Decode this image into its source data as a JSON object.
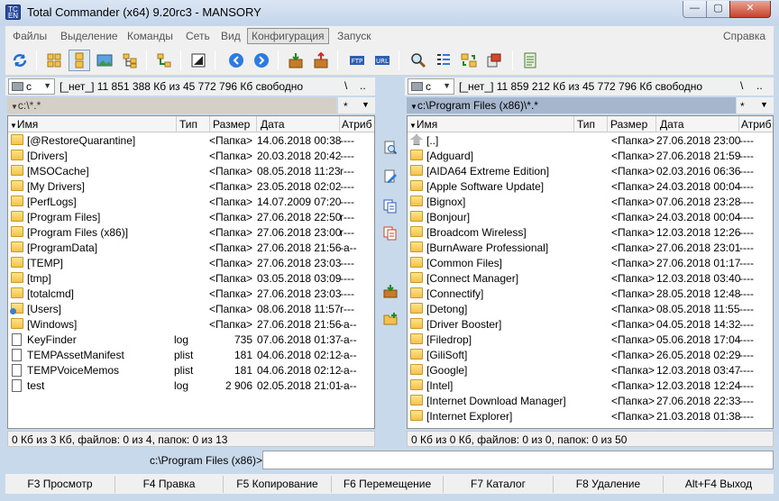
{
  "window": {
    "title": "Total Commander (x64) 9.20rc3 - MANSORY",
    "app_icon_text": "TC\nEN"
  },
  "menu": {
    "items": [
      "Файлы",
      "Выделение",
      "Команды",
      "Сеть",
      "Вид",
      "Конфигурация",
      "Запуск"
    ],
    "help": "Справка"
  },
  "left": {
    "drive": "c",
    "drive_info": "[_нет_]  11 851 388 Кб из 45 772 796 Кб свободно",
    "root": "\\",
    "up": "..",
    "path": "c:\\*.*",
    "filter": "*",
    "columns": {
      "name": "Имя",
      "type": "Тип",
      "size": "Размер",
      "date": "Дата",
      "attr": "Атриб"
    },
    "rows": [
      {
        "icon": "folder",
        "name": "[@RestoreQuarantine]",
        "type": "",
        "size": "<Папка>",
        "date": "14.06.2018 00:38",
        "attr": "----"
      },
      {
        "icon": "folder",
        "name": "[Drivers]",
        "type": "",
        "size": "<Папка>",
        "date": "20.03.2018 20:42",
        "attr": "----"
      },
      {
        "icon": "folder",
        "name": "[MSOCache]",
        "type": "",
        "size": "<Папка>",
        "date": "08.05.2018 11:23",
        "attr": "r---"
      },
      {
        "icon": "folder",
        "name": "[My Drivers]",
        "type": "",
        "size": "<Папка>",
        "date": "23.05.2018 02:02",
        "attr": "----"
      },
      {
        "icon": "folder",
        "name": "[PerfLogs]",
        "type": "",
        "size": "<Папка>",
        "date": "14.07.2009 07:20",
        "attr": "----"
      },
      {
        "icon": "folder",
        "name": "[Program Files]",
        "type": "",
        "size": "<Папка>",
        "date": "27.06.2018 22:50",
        "attr": "r---"
      },
      {
        "icon": "folder",
        "name": "[Program Files (x86)]",
        "type": "",
        "size": "<Папка>",
        "date": "27.06.2018 23:00",
        "attr": "r---"
      },
      {
        "icon": "folder",
        "name": "[ProgramData]",
        "type": "",
        "size": "<Папка>",
        "date": "27.06.2018 21:56",
        "attr": "-a--"
      },
      {
        "icon": "folder",
        "name": "[TEMP]",
        "type": "",
        "size": "<Папка>",
        "date": "27.06.2018 23:03",
        "attr": "----"
      },
      {
        "icon": "folder",
        "name": "[tmp]",
        "type": "",
        "size": "<Папка>",
        "date": "03.05.2018 03:09",
        "attr": "----"
      },
      {
        "icon": "folder",
        "name": "[totalcmd]",
        "type": "",
        "size": "<Папка>",
        "date": "27.06.2018 23:03",
        "attr": "----"
      },
      {
        "icon": "users",
        "name": "[Users]",
        "type": "",
        "size": "<Папка>",
        "date": "08.06.2018 11:57",
        "attr": "r---"
      },
      {
        "icon": "folder",
        "name": "[Windows]",
        "type": "",
        "size": "<Папка>",
        "date": "27.06.2018 21:56",
        "attr": "-a--"
      },
      {
        "icon": "file",
        "name": "KeyFinder",
        "type": "log",
        "size": "735",
        "date": "07.06.2018 01:37",
        "attr": "-a--"
      },
      {
        "icon": "file",
        "name": "TEMPAssetManifest",
        "type": "plist",
        "size": "181",
        "date": "04.06.2018 02:12",
        "attr": "-a--"
      },
      {
        "icon": "file",
        "name": "TEMPVoiceMemos",
        "type": "plist",
        "size": "181",
        "date": "04.06.2018 02:12",
        "attr": "-a--"
      },
      {
        "icon": "file",
        "name": "test",
        "type": "log",
        "size": "2 906",
        "date": "02.05.2018 21:01",
        "attr": "-a--"
      }
    ],
    "status": "0 Кб из 3 Кб, файлов: 0 из 4, папок: 0 из 13"
  },
  "right": {
    "drive": "c",
    "drive_info": "[_нет_]  11 859 212 Кб из 45 772 796 Кб свободно",
    "root": "\\",
    "up": "..",
    "path": "c:\\Program Files (x86)\\*.*",
    "filter": "*",
    "columns": {
      "name": "Имя",
      "type": "Тип",
      "size": "Размер",
      "date": "Дата",
      "attr": "Атриб"
    },
    "rows": [
      {
        "icon": "up",
        "name": "[..]",
        "type": "",
        "size": "<Папка>",
        "date": "27.06.2018 23:00",
        "attr": "----"
      },
      {
        "icon": "folder",
        "name": "[Adguard]",
        "type": "",
        "size": "<Папка>",
        "date": "27.06.2018 21:59",
        "attr": "----"
      },
      {
        "icon": "folder",
        "name": "[AIDA64 Extreme Edition]",
        "type": "",
        "size": "<Папка>",
        "date": "02.03.2016 06:36",
        "attr": "----"
      },
      {
        "icon": "folder",
        "name": "[Apple Software Update]",
        "type": "",
        "size": "<Папка>",
        "date": "24.03.2018 00:04",
        "attr": "----"
      },
      {
        "icon": "folder",
        "name": "[Bignox]",
        "type": "",
        "size": "<Папка>",
        "date": "07.06.2018 23:28",
        "attr": "----"
      },
      {
        "icon": "folder",
        "name": "[Bonjour]",
        "type": "",
        "size": "<Папка>",
        "date": "24.03.2018 00:04",
        "attr": "----"
      },
      {
        "icon": "folder",
        "name": "[Broadcom Wireless]",
        "type": "",
        "size": "<Папка>",
        "date": "12.03.2018 12:26",
        "attr": "----"
      },
      {
        "icon": "folder",
        "name": "[BurnAware Professional]",
        "type": "",
        "size": "<Папка>",
        "date": "27.06.2018 23:01",
        "attr": "----"
      },
      {
        "icon": "folder",
        "name": "[Common Files]",
        "type": "",
        "size": "<Папка>",
        "date": "27.06.2018 01:17",
        "attr": "----"
      },
      {
        "icon": "folder",
        "name": "[Connect Manager]",
        "type": "",
        "size": "<Папка>",
        "date": "12.03.2018 03:40",
        "attr": "----"
      },
      {
        "icon": "folder",
        "name": "[Connectify]",
        "type": "",
        "size": "<Папка>",
        "date": "28.05.2018 12:48",
        "attr": "----"
      },
      {
        "icon": "folder",
        "name": "[Detong]",
        "type": "",
        "size": "<Папка>",
        "date": "08.05.2018 11:55",
        "attr": "----"
      },
      {
        "icon": "folder",
        "name": "[Driver Booster]",
        "type": "",
        "size": "<Папка>",
        "date": "04.05.2018 14:32",
        "attr": "----"
      },
      {
        "icon": "folder",
        "name": "[Filedrop]",
        "type": "",
        "size": "<Папка>",
        "date": "05.06.2018 17:04",
        "attr": "----"
      },
      {
        "icon": "folder",
        "name": "[GiliSoft]",
        "type": "",
        "size": "<Папка>",
        "date": "26.05.2018 02:29",
        "attr": "----"
      },
      {
        "icon": "folder",
        "name": "[Google]",
        "type": "",
        "size": "<Папка>",
        "date": "12.03.2018 03:47",
        "attr": "----"
      },
      {
        "icon": "folder",
        "name": "[Intel]",
        "type": "",
        "size": "<Папка>",
        "date": "12.03.2018 12:24",
        "attr": "----"
      },
      {
        "icon": "folder",
        "name": "[Internet Download Manager]",
        "type": "",
        "size": "<Папка>",
        "date": "27.06.2018 22:33",
        "attr": "----"
      },
      {
        "icon": "folder",
        "name": "[Internet Explorer]",
        "type": "",
        "size": "<Папка>",
        "date": "21.03.2018 01:38",
        "attr": "----"
      }
    ],
    "status": "0 Кб из 0 Кб, файлов: 0 из 0, папок: 0 из 50"
  },
  "command": {
    "label": "c:\\Program Files (x86)>",
    "value": ""
  },
  "fkeys": [
    "F3 Просмотр",
    "F4 Правка",
    "F5 Копирование",
    "F6 Перемещение",
    "F7 Каталог",
    "F8 Удаление",
    "Alt+F4 Выход"
  ],
  "toolbar_icons": [
    "refresh-icon",
    "brief-view-icon",
    "full-view-icon",
    "thumbnails-view-icon",
    "tree-view-icon",
    "tree-sync-icon",
    "invert-selection-icon",
    "back-icon",
    "forward-icon",
    "pack-icon",
    "unpack-icon",
    "ftp-icon",
    "url-icon",
    "search-icon",
    "multi-rename-icon",
    "sync-dirs-icon",
    "copy-names-icon",
    "notepad-icon"
  ],
  "colors": {
    "active_path": "#a6b6cd",
    "inactive_path": "#d4d0c8",
    "folder": "#f4c24a"
  }
}
